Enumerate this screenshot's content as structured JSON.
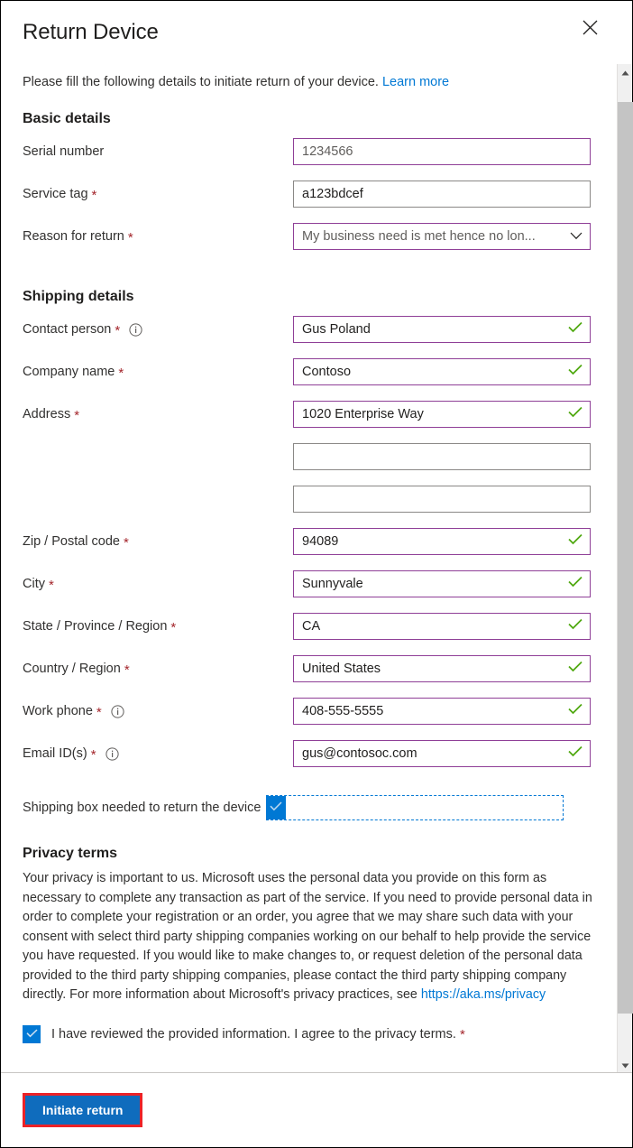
{
  "panel": {
    "title": "Return Device",
    "close_icon": "close-icon",
    "intro_text": "Please fill the following details to initiate return of your device.",
    "intro_link": "Learn more"
  },
  "basic_details": {
    "section_title": "Basic details",
    "fields": [
      {
        "label": "Serial number",
        "required": false,
        "value": "1234566",
        "state": "readonly",
        "border": "purple",
        "validated": false,
        "info": false
      },
      {
        "label": "Service tag",
        "required": true,
        "value": "a123bdcef",
        "state": "editable",
        "border": "gray",
        "validated": false,
        "info": false
      },
      {
        "label": "Reason for return",
        "required": true,
        "value": "My business need is met hence no lon...",
        "state": "dropdown",
        "border": "purple",
        "validated": false,
        "info": false
      }
    ]
  },
  "shipping_details": {
    "section_title": "Shipping details",
    "fields": [
      {
        "label": "Contact person",
        "required": true,
        "value": "Gus Poland",
        "border": "purple",
        "validated": true,
        "info": true
      },
      {
        "label": "Company name",
        "required": true,
        "value": "Contoso",
        "border": "purple",
        "validated": true,
        "info": false
      },
      {
        "label": "Address",
        "required": true,
        "value": "1020 Enterprise Way",
        "border": "purple",
        "validated": true,
        "info": false
      },
      {
        "label": "",
        "required": false,
        "value": "",
        "border": "gray",
        "validated": false,
        "info": false
      },
      {
        "label": "",
        "required": false,
        "value": "",
        "border": "gray",
        "validated": false,
        "info": false
      },
      {
        "label": "Zip / Postal code",
        "required": true,
        "value": "94089",
        "border": "purple",
        "validated": true,
        "info": false
      },
      {
        "label": "City",
        "required": true,
        "value": "Sunnyvale",
        "border": "purple",
        "validated": true,
        "info": false
      },
      {
        "label": "State / Province / Region",
        "required": true,
        "value": "CA",
        "border": "purple",
        "validated": true,
        "info": false
      },
      {
        "label": "Country / Region",
        "required": true,
        "value": "United States",
        "border": "purple",
        "validated": true,
        "info": false
      },
      {
        "label": "Work phone",
        "required": true,
        "value": "408-555-5555",
        "border": "purple",
        "validated": true,
        "info": true
      },
      {
        "label": "Email ID(s)",
        "required": true,
        "value": "gus@contosoc.com",
        "border": "purple",
        "validated": true,
        "info": true
      }
    ],
    "shipping_box": {
      "label": "Shipping box needed to return the device",
      "checked": true
    }
  },
  "privacy": {
    "section_title": "Privacy terms",
    "body": "Your privacy is important to us. Microsoft uses the personal data you provide on this form as necessary to complete any transaction as part of the service. If you need to provide personal data in order to complete your registration or an order, you agree that we may share such data with your consent with select third party shipping companies working on our behalf to help provide the service you have requested. If you would like to make changes to, or request deletion of the personal data provided to the third party shipping companies, please contact the third party shipping company directly. For more information about Microsoft's privacy practices, see",
    "link": "https://aka.ms/privacy",
    "consent_label": "I have reviewed the provided information. I agree to the privacy terms.",
    "consent_checked": true
  },
  "footer": {
    "primary_button": "Initiate return"
  },
  "scrollbar": {
    "up_icon": "scroll-up-arrow-icon",
    "down_icon": "scroll-down-arrow-icon"
  },
  "colors": {
    "accent_blue": "#0078d4",
    "button_blue": "#0f6cbd",
    "annotation_red": "#ec2227",
    "required_red": "#a4262c",
    "field_purple": "#8f3f97",
    "valid_green": "#4fa80f",
    "link_blue": "#0078d4"
  }
}
